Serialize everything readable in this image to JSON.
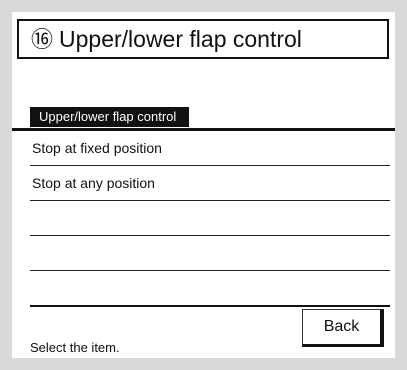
{
  "title": {
    "number_symbol": "⑯",
    "text": "Upper/lower flap control"
  },
  "list": {
    "header": "Upper/lower flap control",
    "items": [
      {
        "label": "Stop at fixed position"
      },
      {
        "label": "Stop at any position"
      },
      {
        "label": ""
      },
      {
        "label": ""
      },
      {
        "label": ""
      }
    ]
  },
  "footer": {
    "status": "Select the item.",
    "back_label": "Back"
  }
}
